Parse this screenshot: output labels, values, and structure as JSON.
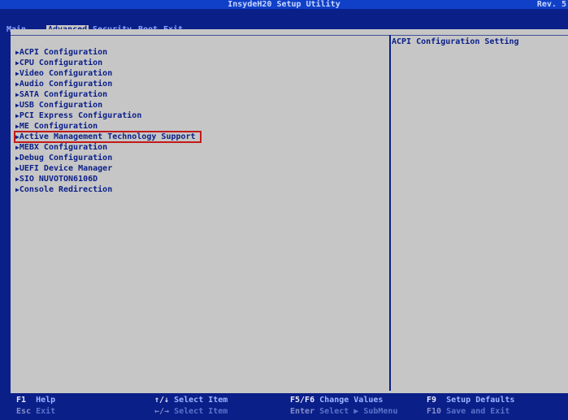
{
  "titlebar": {
    "title": "InsydeH20 Setup Utility",
    "rev": "Rev. 5"
  },
  "tabs": [
    "Main",
    "Advanced",
    "Security",
    "Boot",
    "Exit"
  ],
  "selected_tab": "Advanced",
  "menu_items": [
    "ACPI Configuration",
    "CPU Configuration",
    "Video Configuration",
    "Audio Configuration",
    "SATA Configuration",
    "USB Configuration",
    "PCI Express Configuration",
    "ME Configuration",
    "Active Management Technology Support",
    "MEBX Configuration",
    "Debug Configuration",
    "UEFI Device Manager",
    "SIO NUVOTON6106D",
    "Console Redirection"
  ],
  "highlighted_item": "Active Management Technology Support",
  "help_text": "ACPI Configuration Setting",
  "footer": {
    "row1": [
      {
        "key": "F1",
        "desc": "Help"
      },
      {
        "key": "↑/↓",
        "desc": "Select Item"
      },
      {
        "key": "F5/F6",
        "desc": "Change Values"
      },
      {
        "key": "F9",
        "desc": "Setup Defaults"
      }
    ],
    "row2": [
      {
        "key": "Esc",
        "desc": "Exit"
      },
      {
        "key": "←/→",
        "desc": "Select Item"
      },
      {
        "key": "Enter",
        "desc": "Select ▶ SubMenu"
      },
      {
        "key": "F10",
        "desc": "Save and Exit"
      }
    ]
  },
  "colors": {
    "background": "#0a1f88",
    "panel": "#c6c6c6",
    "text": "#0a1f88",
    "highlight_border": "#c21a1a"
  }
}
